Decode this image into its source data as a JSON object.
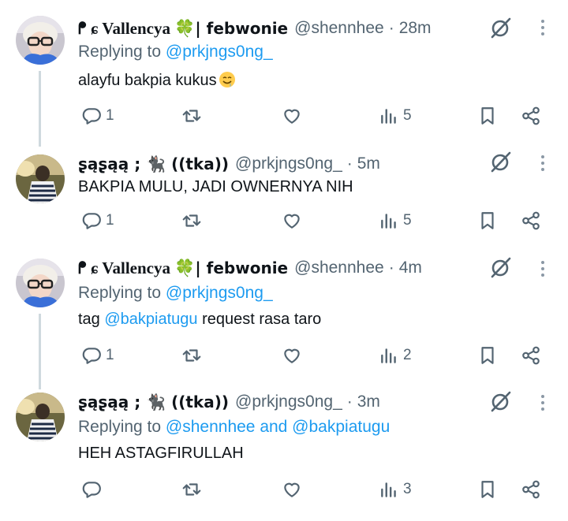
{
  "tweets": [
    {
      "display_name": "ᖰ ɕ Vallencya",
      "display_name_suffix": "| febwonie",
      "badge": "🍀",
      "handle": "@shennhee",
      "time": "28m",
      "replying_prefix": "Replying to",
      "replying_to": "@prkjngs0ng_",
      "text": "alayfu bakpia kukus",
      "text_emoji": "drooling-face",
      "replies": "1",
      "reposts": "",
      "likes": "",
      "views": "5"
    },
    {
      "display_name": "ʂąʂąą ; 🐈‍⬛ ((tka))",
      "handle": "@prkjngs0ng_",
      "time": "5m",
      "text": "BAKPIA MULU, JADI OWNERNYA NIH",
      "replies": "1",
      "reposts": "",
      "likes": "",
      "views": "5"
    },
    {
      "display_name": "ᖰ ɕ Vallencya",
      "display_name_suffix": "| febwonie",
      "badge": "🍀",
      "handle": "@shennhee",
      "time": "4m",
      "replying_prefix": "Replying to",
      "replying_to": "@prkjngs0ng_",
      "text_prefix": "tag",
      "text_mention": "@bakpiatugu",
      "text_suffix": "request rasa taro",
      "replies": "1",
      "reposts": "",
      "likes": "",
      "views": "2"
    },
    {
      "display_name": "ʂąʂąą ; 🐈‍⬛ ((tka))",
      "handle": "@prkjngs0ng_",
      "time": "3m",
      "replying_prefix": "Replying to",
      "replying_to": "@shennhee and @bakpiatugu",
      "text": "HEH ASTAGFIRULLAH",
      "replies": "",
      "reposts": "",
      "likes": "",
      "views": "3"
    }
  ],
  "separator": "·",
  "icons": {
    "reply": "reply-icon",
    "repost": "repost-icon",
    "like": "heart-icon",
    "views": "views-icon",
    "bookmark": "bookmark-icon",
    "share": "share-icon",
    "grok": "grok-icon",
    "more": "more-icon"
  },
  "colors": {
    "link": "#1d9bf0",
    "secondary": "#536471",
    "text": "#0f1419",
    "thread_line": "#cfd9de"
  }
}
